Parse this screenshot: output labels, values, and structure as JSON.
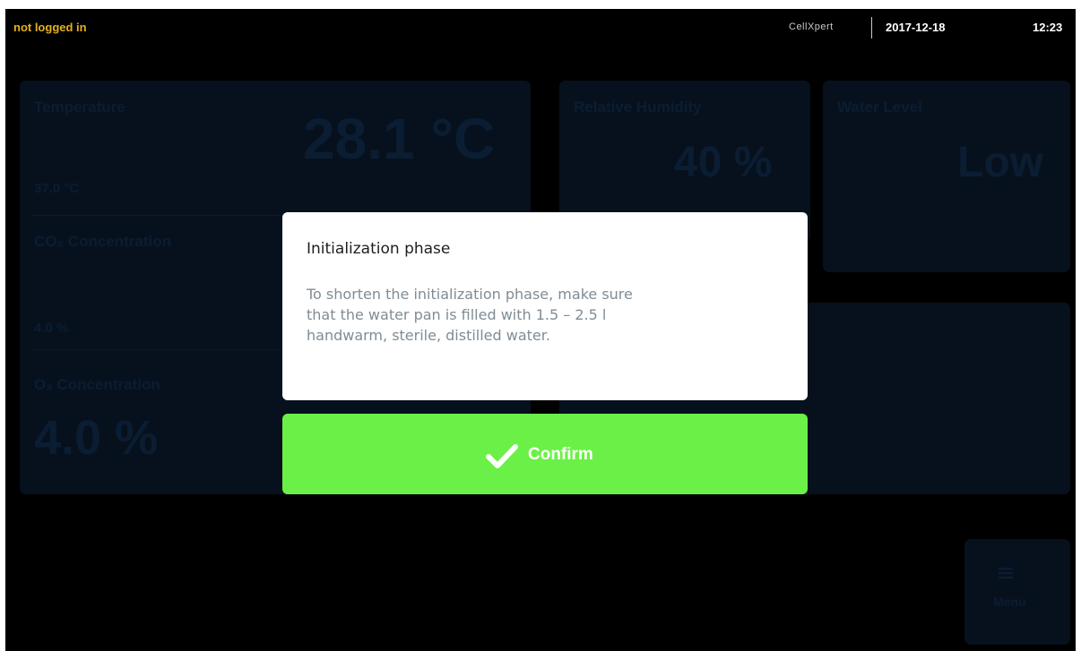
{
  "status_bar": {
    "login_status": "not logged in",
    "brand": "CellXpert",
    "date": "2017-12-18",
    "time": "12:23"
  },
  "dashboard": {
    "temperature": {
      "label": "Temperature",
      "value": "28.1 °C",
      "setpoint": "37.0 °C"
    },
    "co2": {
      "label": "CO₂ Concentration",
      "setpoint": "4.0 %"
    },
    "o2": {
      "label": "O₂ Concentration",
      "value": "4.0 %"
    },
    "humidity": {
      "label": "Relative Humidity",
      "value": "40 %"
    },
    "water_level": {
      "label": "Water Level",
      "value": "Low"
    },
    "menu": {
      "label": "Menu"
    }
  },
  "modal": {
    "title": "Initialization phase",
    "body_lines": [
      "To shorten the initialization phase, make sure",
      "that the water pan is filled with 1.5 – 2.5 l",
      "handwarm, sterile, distilled water."
    ],
    "confirm_label": "Confirm"
  },
  "colors": {
    "login_status": "#e5b11d",
    "confirm_button": "#6bf047",
    "modal_background": "#ffffff",
    "screen_background": "#000000"
  },
  "icons": {
    "confirm": "check-icon",
    "menu": "menu-icon"
  }
}
